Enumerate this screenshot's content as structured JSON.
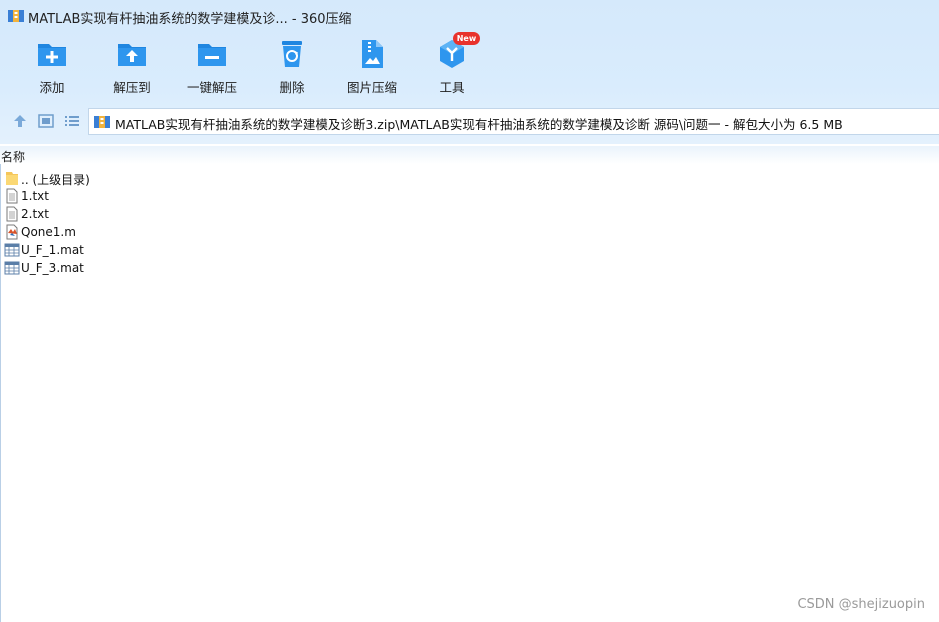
{
  "window": {
    "title": "MATLAB实现有杆抽油系统的数学建模及诊... - 360压缩"
  },
  "toolbar": {
    "items": [
      {
        "label": "添加",
        "icon": "add-folder-icon"
      },
      {
        "label": "解压到",
        "icon": "extract-to-icon"
      },
      {
        "label": "一键解压",
        "icon": "one-click-extract-icon"
      },
      {
        "label": "删除",
        "icon": "recycle-bin-icon"
      },
      {
        "label": "图片压缩",
        "icon": "image-compress-icon"
      },
      {
        "label": "工具",
        "icon": "tools-cube-icon"
      }
    ],
    "badge": "New",
    "accent": "#2b8ce6"
  },
  "address": {
    "path": "MATLAB实现有杆抽油系统的数学建模及诊断3.zip\\MATLAB实现有杆抽油系统的数学建模及诊断 源码\\问题一 - 解包大小为 6.5 MB"
  },
  "list": {
    "column_name": "名称",
    "files": [
      {
        "name": ".. (上级目录)",
        "icon": "folder-icon"
      },
      {
        "name": "1.txt",
        "icon": "text-file-icon"
      },
      {
        "name": "2.txt",
        "icon": "text-file-icon"
      },
      {
        "name": "Qone1.m",
        "icon": "matlab-file-icon"
      },
      {
        "name": "U_F_1.mat",
        "icon": "mat-data-icon"
      },
      {
        "name": "U_F_3.mat",
        "icon": "mat-data-icon"
      }
    ]
  },
  "watermark": "CSDN @shejizuopin"
}
